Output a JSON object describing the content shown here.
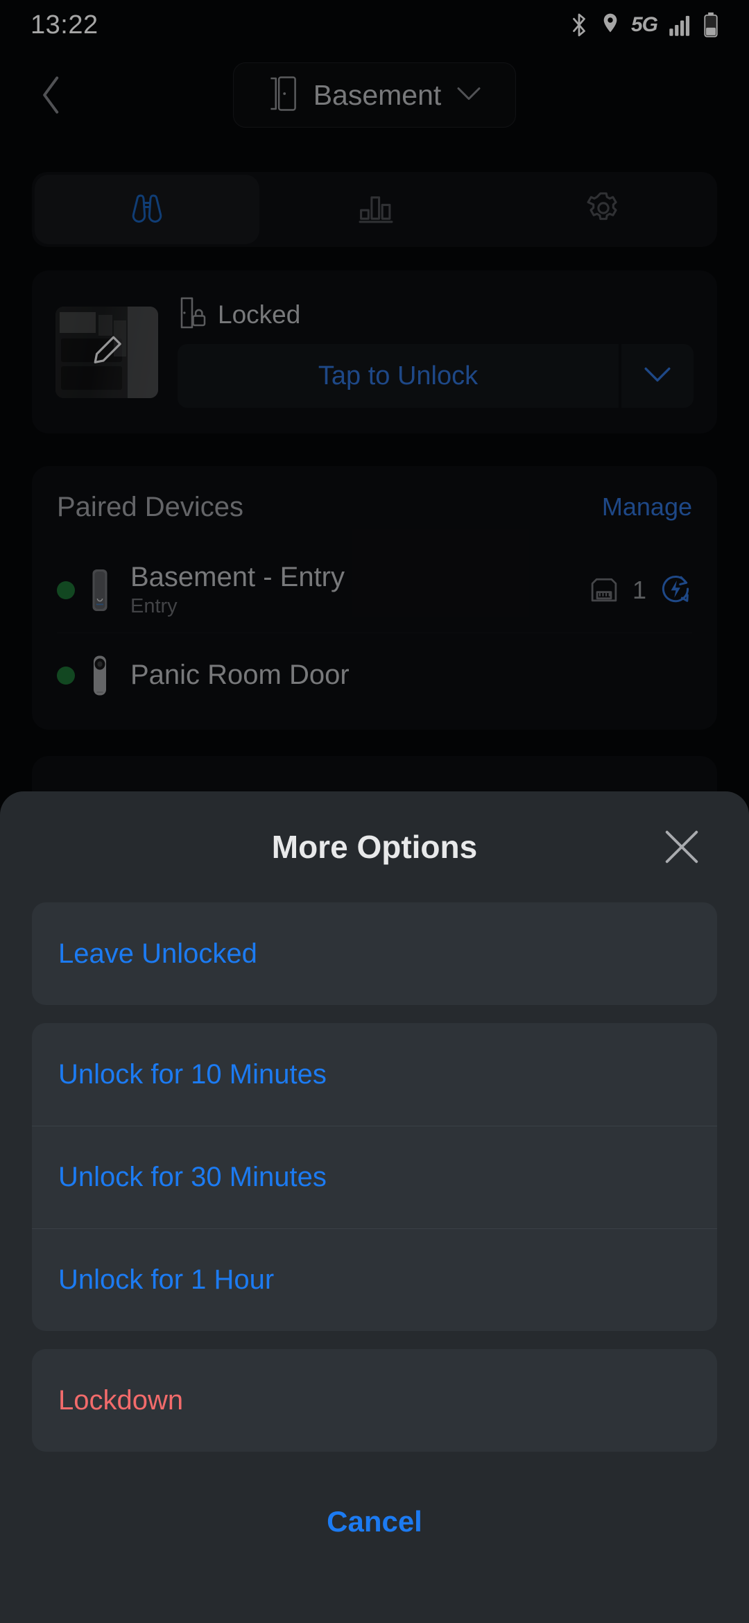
{
  "status_bar": {
    "time": "13:22",
    "icons": [
      "bluetooth-icon",
      "location-icon",
      "5g-icon",
      "signal-icon",
      "battery-icon"
    ],
    "network_label": "5G"
  },
  "header": {
    "back_icon": "chevron-left-icon",
    "room_icon": "door-icon",
    "room_name": "Basement",
    "dropdown_icon": "chevron-down-icon"
  },
  "tabs": [
    {
      "name": "overview",
      "icon": "binoculars-icon",
      "active": true
    },
    {
      "name": "activity",
      "icon": "bar-chart-icon",
      "active": false
    },
    {
      "name": "settings",
      "icon": "gear-icon",
      "active": false
    }
  ],
  "lock_card": {
    "thumbnail_icon": "edit-pencil-icon",
    "status_icon": "door-lock-icon",
    "status_text": "Locked",
    "unlock_label": "Tap to Unlock",
    "more_icon": "chevron-down-icon"
  },
  "paired_devices": {
    "title": "Paired Devices",
    "manage_label": "Manage",
    "items": [
      {
        "name": "Basement - Entry",
        "subtitle": "Entry",
        "status": "online",
        "device_icon": "reader-device-icon",
        "port_icon": "ethernet-port-icon",
        "port_count": "1",
        "power_icon": "power-cycle-icon"
      },
      {
        "name": "Panic Room Door",
        "subtitle": "",
        "status": "online",
        "device_icon": "camera-device-icon"
      }
    ]
  },
  "sheet": {
    "title": "More Options",
    "close_icon": "close-icon",
    "groups": [
      {
        "options": [
          {
            "label": "Leave Unlocked",
            "style": "primary"
          }
        ]
      },
      {
        "options": [
          {
            "label": "Unlock for 10 Minutes",
            "style": "primary"
          },
          {
            "label": "Unlock for 30 Minutes",
            "style": "primary"
          },
          {
            "label": "Unlock for 1 Hour",
            "style": "primary"
          }
        ]
      },
      {
        "options": [
          {
            "label": "Lockdown",
            "style": "danger"
          }
        ]
      }
    ],
    "cancel_label": "Cancel"
  },
  "colors": {
    "accent_blue": "#1c7bf2",
    "muted_blue": "#2f6fd0",
    "danger_red": "#f26b6b",
    "online_green": "#1d6e33",
    "background": "#060709",
    "sheet_background": "#262a2e"
  }
}
